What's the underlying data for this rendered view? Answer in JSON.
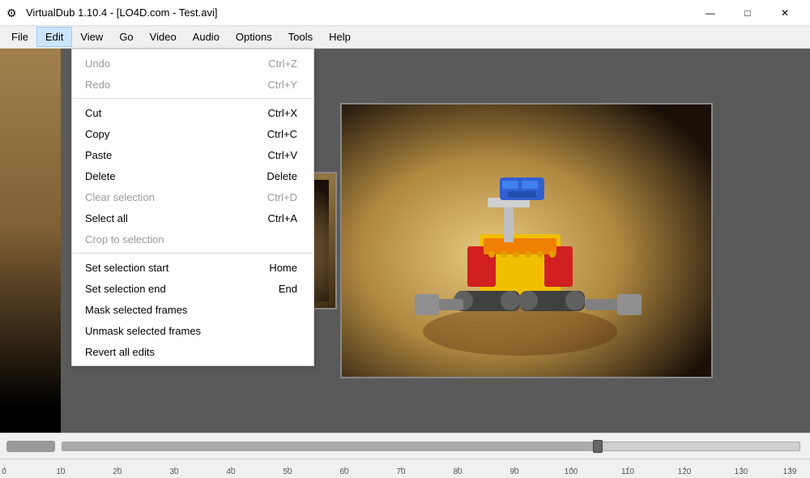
{
  "titleBar": {
    "icon": "⚙",
    "title": "VirtualDub 1.10.4 - [LO4D.com - Test.avi]",
    "controls": {
      "minimize": "—",
      "maximize": "□",
      "close": "✕"
    }
  },
  "menuBar": {
    "items": [
      {
        "id": "file",
        "label": "File"
      },
      {
        "id": "edit",
        "label": "Edit",
        "active": true
      },
      {
        "id": "view",
        "label": "View"
      },
      {
        "id": "go",
        "label": "Go"
      },
      {
        "id": "video",
        "label": "Video"
      },
      {
        "id": "audio",
        "label": "Audio"
      },
      {
        "id": "options",
        "label": "Options"
      },
      {
        "id": "tools",
        "label": "Tools"
      },
      {
        "id": "help",
        "label": "Help"
      }
    ]
  },
  "editMenu": {
    "items": [
      {
        "id": "undo",
        "label": "Undo",
        "shortcut": "Ctrl+Z",
        "disabled": true
      },
      {
        "id": "redo",
        "label": "Redo",
        "shortcut": "Ctrl+Y",
        "disabled": true
      },
      {
        "separator": true
      },
      {
        "id": "cut",
        "label": "Cut",
        "shortcut": "Ctrl+X"
      },
      {
        "id": "copy",
        "label": "Copy",
        "shortcut": "Ctrl+C"
      },
      {
        "id": "paste",
        "label": "Paste",
        "shortcut": "Ctrl+V"
      },
      {
        "id": "delete",
        "label": "Delete",
        "shortcut": "Delete"
      },
      {
        "id": "clear-selection",
        "label": "Clear selection",
        "shortcut": "Ctrl+D",
        "disabled": true
      },
      {
        "id": "select-all",
        "label": "Select all",
        "shortcut": "Ctrl+A"
      },
      {
        "id": "crop-to-selection",
        "label": "Crop to selection",
        "shortcut": "",
        "disabled": true
      },
      {
        "separator": true
      },
      {
        "id": "set-selection-start",
        "label": "Set selection start",
        "shortcut": "Home"
      },
      {
        "id": "set-selection-end",
        "label": "Set selection end",
        "shortcut": "End"
      },
      {
        "id": "mask-selected-frames",
        "label": "Mask selected frames",
        "shortcut": ""
      },
      {
        "id": "unmask-selected-frames",
        "label": "Unmask selected frames",
        "shortcut": ""
      },
      {
        "id": "revert-all-edits",
        "label": "Revert all edits",
        "shortcut": ""
      }
    ]
  },
  "timeline": {
    "handlePosition": 73,
    "marks": [
      {
        "value": "0",
        "pos": 0.5
      },
      {
        "value": "10",
        "pos": 7.5
      },
      {
        "value": "20",
        "pos": 14.5
      },
      {
        "value": "30",
        "pos": 21.5
      },
      {
        "value": "40",
        "pos": 28.5
      },
      {
        "value": "50",
        "pos": 35.5
      },
      {
        "value": "60",
        "pos": 42.5
      },
      {
        "value": "70",
        "pos": 49.5
      },
      {
        "value": "80",
        "pos": 56.5
      },
      {
        "value": "90",
        "pos": 63.5
      },
      {
        "value": "100",
        "pos": 70.5
      },
      {
        "value": "110",
        "pos": 77.5
      },
      {
        "value": "120",
        "pos": 84.5
      },
      {
        "value": "130",
        "pos": 91.5
      },
      {
        "value": "139",
        "pos": 97.5
      }
    ]
  }
}
